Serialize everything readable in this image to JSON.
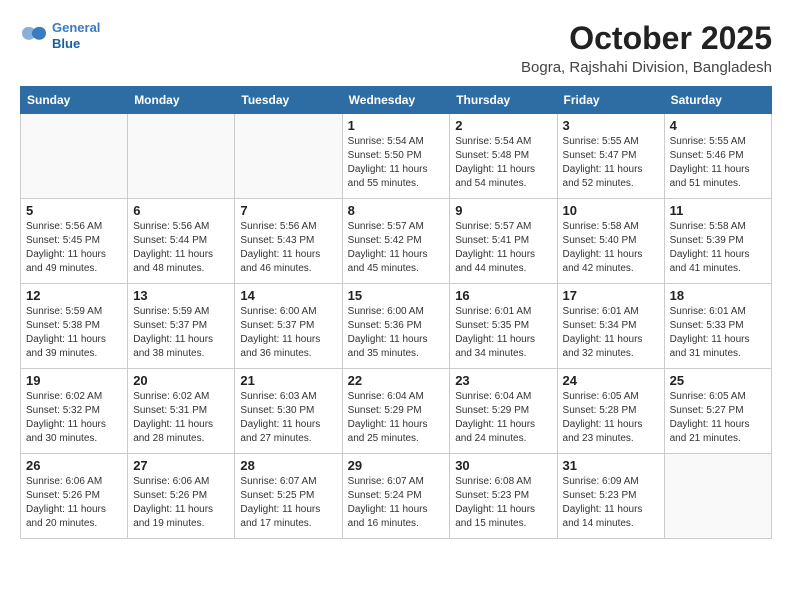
{
  "logo": {
    "line1": "General",
    "line2": "Blue"
  },
  "title": "October 2025",
  "subtitle": "Bogra, Rajshahi Division, Bangladesh",
  "weekdays": [
    "Sunday",
    "Monday",
    "Tuesday",
    "Wednesday",
    "Thursday",
    "Friday",
    "Saturday"
  ],
  "weeks": [
    [
      {
        "day": "",
        "info": ""
      },
      {
        "day": "",
        "info": ""
      },
      {
        "day": "",
        "info": ""
      },
      {
        "day": "1",
        "info": "Sunrise: 5:54 AM\nSunset: 5:50 PM\nDaylight: 11 hours\nand 55 minutes."
      },
      {
        "day": "2",
        "info": "Sunrise: 5:54 AM\nSunset: 5:48 PM\nDaylight: 11 hours\nand 54 minutes."
      },
      {
        "day": "3",
        "info": "Sunrise: 5:55 AM\nSunset: 5:47 PM\nDaylight: 11 hours\nand 52 minutes."
      },
      {
        "day": "4",
        "info": "Sunrise: 5:55 AM\nSunset: 5:46 PM\nDaylight: 11 hours\nand 51 minutes."
      }
    ],
    [
      {
        "day": "5",
        "info": "Sunrise: 5:56 AM\nSunset: 5:45 PM\nDaylight: 11 hours\nand 49 minutes."
      },
      {
        "day": "6",
        "info": "Sunrise: 5:56 AM\nSunset: 5:44 PM\nDaylight: 11 hours\nand 48 minutes."
      },
      {
        "day": "7",
        "info": "Sunrise: 5:56 AM\nSunset: 5:43 PM\nDaylight: 11 hours\nand 46 minutes."
      },
      {
        "day": "8",
        "info": "Sunrise: 5:57 AM\nSunset: 5:42 PM\nDaylight: 11 hours\nand 45 minutes."
      },
      {
        "day": "9",
        "info": "Sunrise: 5:57 AM\nSunset: 5:41 PM\nDaylight: 11 hours\nand 44 minutes."
      },
      {
        "day": "10",
        "info": "Sunrise: 5:58 AM\nSunset: 5:40 PM\nDaylight: 11 hours\nand 42 minutes."
      },
      {
        "day": "11",
        "info": "Sunrise: 5:58 AM\nSunset: 5:39 PM\nDaylight: 11 hours\nand 41 minutes."
      }
    ],
    [
      {
        "day": "12",
        "info": "Sunrise: 5:59 AM\nSunset: 5:38 PM\nDaylight: 11 hours\nand 39 minutes."
      },
      {
        "day": "13",
        "info": "Sunrise: 5:59 AM\nSunset: 5:37 PM\nDaylight: 11 hours\nand 38 minutes."
      },
      {
        "day": "14",
        "info": "Sunrise: 6:00 AM\nSunset: 5:37 PM\nDaylight: 11 hours\nand 36 minutes."
      },
      {
        "day": "15",
        "info": "Sunrise: 6:00 AM\nSunset: 5:36 PM\nDaylight: 11 hours\nand 35 minutes."
      },
      {
        "day": "16",
        "info": "Sunrise: 6:01 AM\nSunset: 5:35 PM\nDaylight: 11 hours\nand 34 minutes."
      },
      {
        "day": "17",
        "info": "Sunrise: 6:01 AM\nSunset: 5:34 PM\nDaylight: 11 hours\nand 32 minutes."
      },
      {
        "day": "18",
        "info": "Sunrise: 6:01 AM\nSunset: 5:33 PM\nDaylight: 11 hours\nand 31 minutes."
      }
    ],
    [
      {
        "day": "19",
        "info": "Sunrise: 6:02 AM\nSunset: 5:32 PM\nDaylight: 11 hours\nand 30 minutes."
      },
      {
        "day": "20",
        "info": "Sunrise: 6:02 AM\nSunset: 5:31 PM\nDaylight: 11 hours\nand 28 minutes."
      },
      {
        "day": "21",
        "info": "Sunrise: 6:03 AM\nSunset: 5:30 PM\nDaylight: 11 hours\nand 27 minutes."
      },
      {
        "day": "22",
        "info": "Sunrise: 6:04 AM\nSunset: 5:29 PM\nDaylight: 11 hours\nand 25 minutes."
      },
      {
        "day": "23",
        "info": "Sunrise: 6:04 AM\nSunset: 5:29 PM\nDaylight: 11 hours\nand 24 minutes."
      },
      {
        "day": "24",
        "info": "Sunrise: 6:05 AM\nSunset: 5:28 PM\nDaylight: 11 hours\nand 23 minutes."
      },
      {
        "day": "25",
        "info": "Sunrise: 6:05 AM\nSunset: 5:27 PM\nDaylight: 11 hours\nand 21 minutes."
      }
    ],
    [
      {
        "day": "26",
        "info": "Sunrise: 6:06 AM\nSunset: 5:26 PM\nDaylight: 11 hours\nand 20 minutes."
      },
      {
        "day": "27",
        "info": "Sunrise: 6:06 AM\nSunset: 5:26 PM\nDaylight: 11 hours\nand 19 minutes."
      },
      {
        "day": "28",
        "info": "Sunrise: 6:07 AM\nSunset: 5:25 PM\nDaylight: 11 hours\nand 17 minutes."
      },
      {
        "day": "29",
        "info": "Sunrise: 6:07 AM\nSunset: 5:24 PM\nDaylight: 11 hours\nand 16 minutes."
      },
      {
        "day": "30",
        "info": "Sunrise: 6:08 AM\nSunset: 5:23 PM\nDaylight: 11 hours\nand 15 minutes."
      },
      {
        "day": "31",
        "info": "Sunrise: 6:09 AM\nSunset: 5:23 PM\nDaylight: 11 hours\nand 14 minutes."
      },
      {
        "day": "",
        "info": ""
      }
    ]
  ]
}
